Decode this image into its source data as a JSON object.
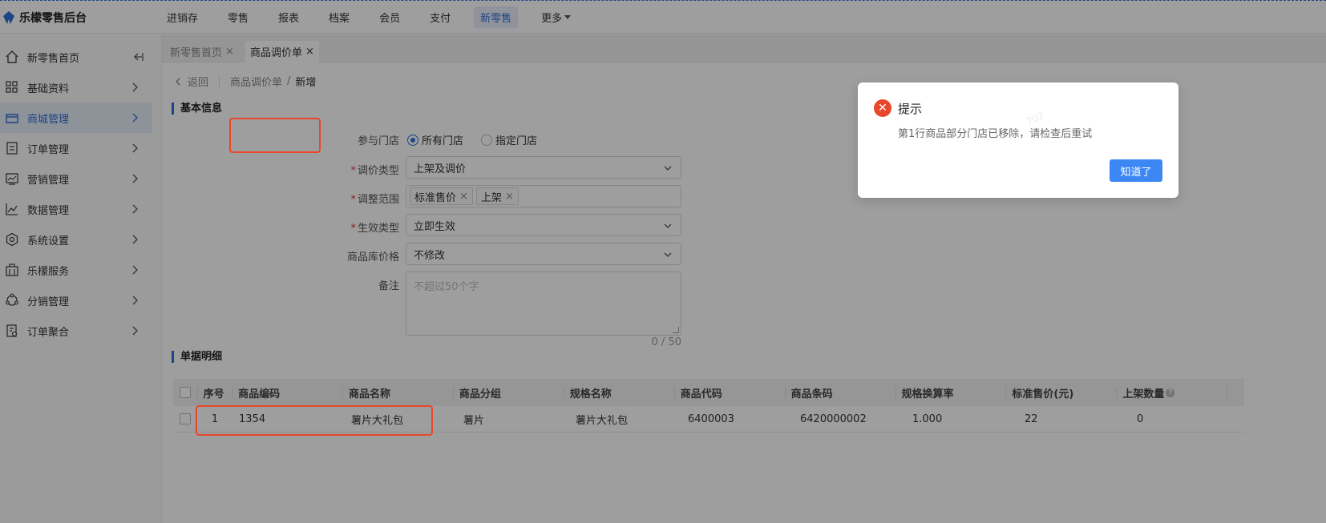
{
  "app": {
    "title": "乐檬零售后台"
  },
  "top_nav": {
    "items": [
      {
        "label": "进销存"
      },
      {
        "label": "零售"
      },
      {
        "label": "报表"
      },
      {
        "label": "档案"
      },
      {
        "label": "会员"
      },
      {
        "label": "支付"
      },
      {
        "label": "新零售",
        "active": true
      },
      {
        "label": "更多"
      }
    ]
  },
  "sidebar": {
    "items": [
      {
        "label": "新零售首页",
        "icon": "home-icon"
      },
      {
        "label": "基础资料",
        "icon": "grid-icon"
      },
      {
        "label": "商城管理",
        "icon": "store-icon",
        "active": true
      },
      {
        "label": "订单管理",
        "icon": "order-icon"
      },
      {
        "label": "营销管理",
        "icon": "marketing-icon"
      },
      {
        "label": "数据管理",
        "icon": "chart-line-icon"
      },
      {
        "label": "系统设置",
        "icon": "settings-icon"
      },
      {
        "label": "乐檬服务",
        "icon": "service-icon"
      },
      {
        "label": "分销管理",
        "icon": "distribution-icon"
      },
      {
        "label": "订单聚合",
        "icon": "order-aggregate-icon"
      }
    ]
  },
  "tabs": [
    {
      "label": "新零售首页",
      "active": false
    },
    {
      "label": "商品调价单",
      "active": true
    }
  ],
  "breadcrumb": {
    "back": "返回",
    "parent": "商品调价单",
    "separator": "/",
    "current": "新增"
  },
  "basic_info": {
    "title": "基本信息",
    "stores": {
      "label": "参与门店",
      "options": [
        "所有门店",
        "指定门店"
      ],
      "selected": "所有门店"
    },
    "price_type": {
      "label": "调价类型",
      "value": "上架及调价"
    },
    "scope": {
      "label": "调整范围",
      "tags": [
        "标准售价",
        "上架"
      ]
    },
    "effect_type": {
      "label": "生效类型",
      "value": "立即生效"
    },
    "stock_price": {
      "label": "商品库价格",
      "value": "不修改"
    },
    "remark": {
      "label": "备注",
      "placeholder": "不超过50个字",
      "counter": "0 / 50"
    }
  },
  "detail": {
    "title": "单据明细",
    "columns": [
      "序号",
      "商品编码",
      "商品名称",
      "商品分组",
      "规格名称",
      "商品代码",
      "商品条码",
      "规格换算率",
      "标准售价(元)",
      "上架数量"
    ],
    "rows": [
      [
        "1",
        "1354",
        "薯片大礼包",
        "薯片",
        "薯片大礼包",
        "6400003",
        "6420000002",
        "1.000",
        "22",
        "0"
      ]
    ]
  },
  "modal": {
    "title": "提示",
    "message": "第1行商品部分门店已移除，请检查后重试",
    "confirm": "知道了",
    "icon": "error-icon",
    "watermark": "702"
  },
  "colors": {
    "accent": "#2f6fd6",
    "error": "#e8472b",
    "button": "#3d87f5"
  }
}
